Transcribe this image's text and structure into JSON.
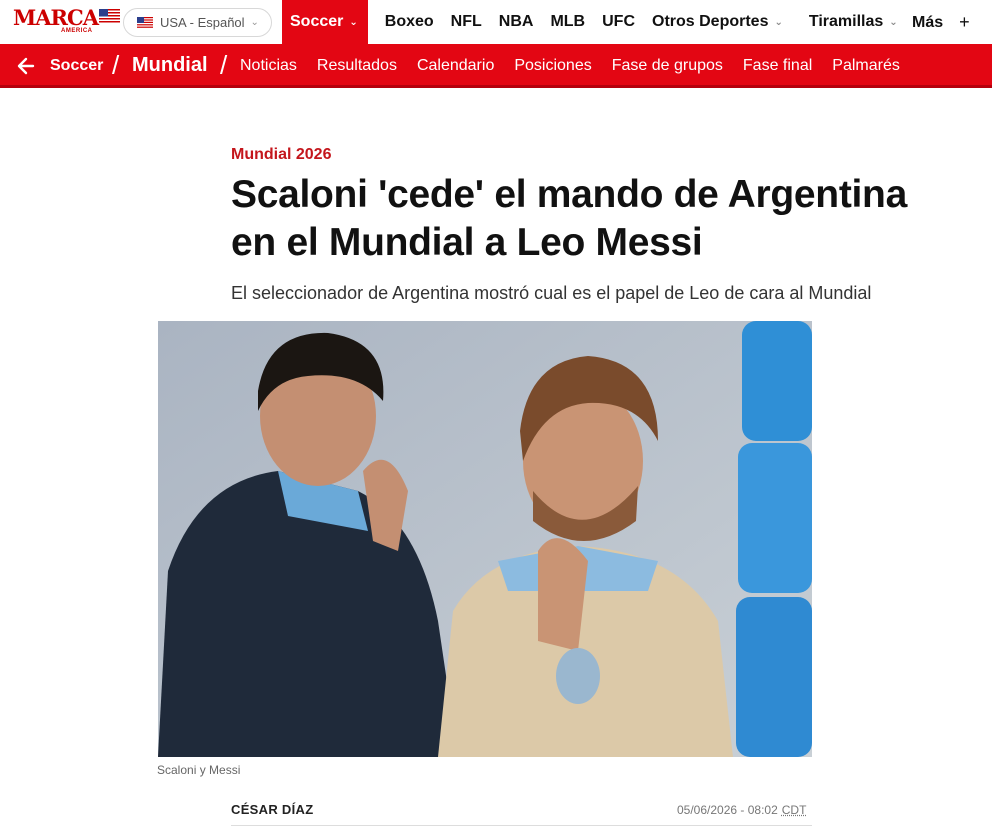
{
  "brand": {
    "name": "MARCA",
    "edition": "AMERICA"
  },
  "language_selector": {
    "label": "USA - Español"
  },
  "top_nav": {
    "active": "Soccer",
    "items": [
      "Boxeo",
      "NFL",
      "NBA",
      "MLB",
      "UFC",
      "Otros Deportes",
      "Tiramillas"
    ],
    "more": "Más"
  },
  "section_bar": {
    "parent": "Soccer",
    "current": "Mundial",
    "links": [
      "Noticias",
      "Resultados",
      "Calendario",
      "Posiciones",
      "Fase de grupos",
      "Fase final",
      "Palmarés"
    ]
  },
  "article": {
    "kicker": "Mundial 2026",
    "headline_line1": "Scaloni 'cede' el mando de Argentina",
    "headline_line2": "en el Mundial a Leo Messi",
    "subheadline": "El seleccionador de Argentina mostró cual es el papel de Leo de cara al Mundial",
    "image_caption": "Scaloni y Messi",
    "author": "CÉSAR DÍAZ",
    "date": "05/06/2026 - 08:02",
    "timezone": "CDT"
  },
  "colors": {
    "brand_red": "#e30613",
    "kicker_red": "#c4161c"
  }
}
